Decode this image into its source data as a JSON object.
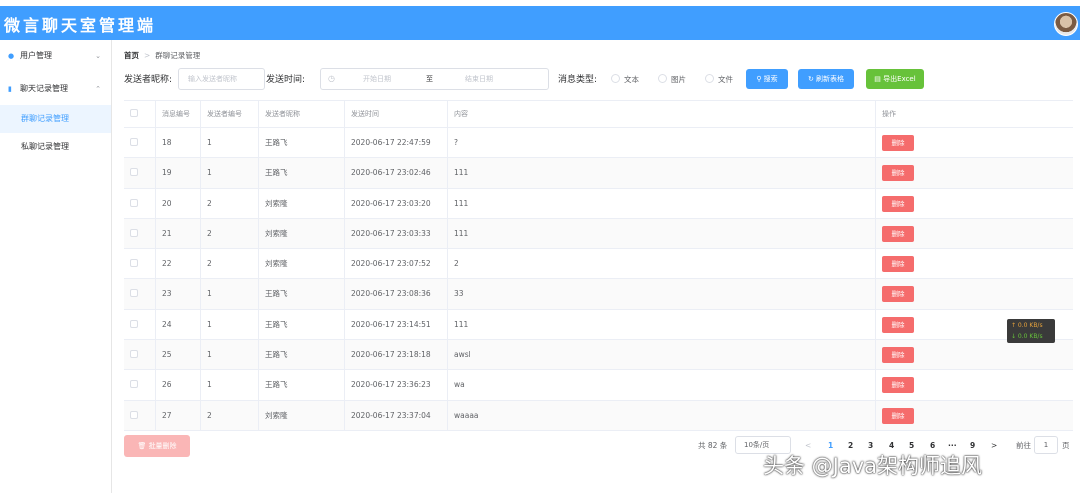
{
  "app": {
    "title": "微言聊天室管理端"
  },
  "sidebar": {
    "items": [
      {
        "label": "用户管理",
        "icon": "user-icon"
      },
      {
        "label": "聊天记录管理",
        "icon": "book-icon"
      }
    ],
    "submenu": [
      {
        "label": "群聊记录管理",
        "active": true
      },
      {
        "label": "私聊记录管理",
        "active": false
      }
    ]
  },
  "breadcrumb": {
    "home": "首页",
    "separator": ">",
    "current": "群聊记录管理"
  },
  "filters": {
    "sender_label": "发送者昵称:",
    "sender_placeholder": "输入发送者昵称",
    "time_label": "发送时间:",
    "start_placeholder": "开始日期",
    "to": "至",
    "end_placeholder": "结束日期",
    "type_label": "消息类型:",
    "types": [
      "文本",
      "图片",
      "文件"
    ],
    "search_button": "搜索",
    "refresh_button": "刷新表格",
    "export_button": "导出Excel"
  },
  "table": {
    "headers": [
      "消息编号",
      "发送者编号",
      "发送者昵称",
      "发送时间",
      "内容",
      "操作"
    ],
    "delete_label": "删除",
    "rows": [
      {
        "id": "18",
        "sender_id": "1",
        "nickname": "王路飞",
        "time": "2020-06-17 22:47:59",
        "content": "?"
      },
      {
        "id": "19",
        "sender_id": "1",
        "nickname": "王路飞",
        "time": "2020-06-17 23:02:46",
        "content": "111"
      },
      {
        "id": "20",
        "sender_id": "2",
        "nickname": "刘索隆",
        "time": "2020-06-17 23:03:20",
        "content": "111"
      },
      {
        "id": "21",
        "sender_id": "2",
        "nickname": "刘索隆",
        "time": "2020-06-17 23:03:33",
        "content": "111"
      },
      {
        "id": "22",
        "sender_id": "2",
        "nickname": "刘索隆",
        "time": "2020-06-17 23:07:52",
        "content": "2"
      },
      {
        "id": "23",
        "sender_id": "1",
        "nickname": "王路飞",
        "time": "2020-06-17 23:08:36",
        "content": "33"
      },
      {
        "id": "24",
        "sender_id": "1",
        "nickname": "王路飞",
        "time": "2020-06-17 23:14:51",
        "content": "111"
      },
      {
        "id": "25",
        "sender_id": "1",
        "nickname": "王路飞",
        "time": "2020-06-17 23:18:18",
        "content": "awsl"
      },
      {
        "id": "26",
        "sender_id": "1",
        "nickname": "王路飞",
        "time": "2020-06-17 23:36:23",
        "content": "wa"
      },
      {
        "id": "27",
        "sender_id": "2",
        "nickname": "刘索隆",
        "time": "2020-06-17 23:37:04",
        "content": "waaaa"
      }
    ]
  },
  "batch_delete": "批量删除",
  "pagination": {
    "total": "共 82 条",
    "page_size": "10条/页",
    "prev": "<",
    "pages": [
      "1",
      "2",
      "3",
      "4",
      "5",
      "6",
      "···",
      "9"
    ],
    "next": ">",
    "goto_label": "前往",
    "goto_value": "1",
    "page_unit": "页"
  },
  "net_widget": {
    "up": "↑ 0.0 KB/s",
    "down": "↓ 0.0 KB/s"
  },
  "watermark": "头条 @Java架构师追风"
}
